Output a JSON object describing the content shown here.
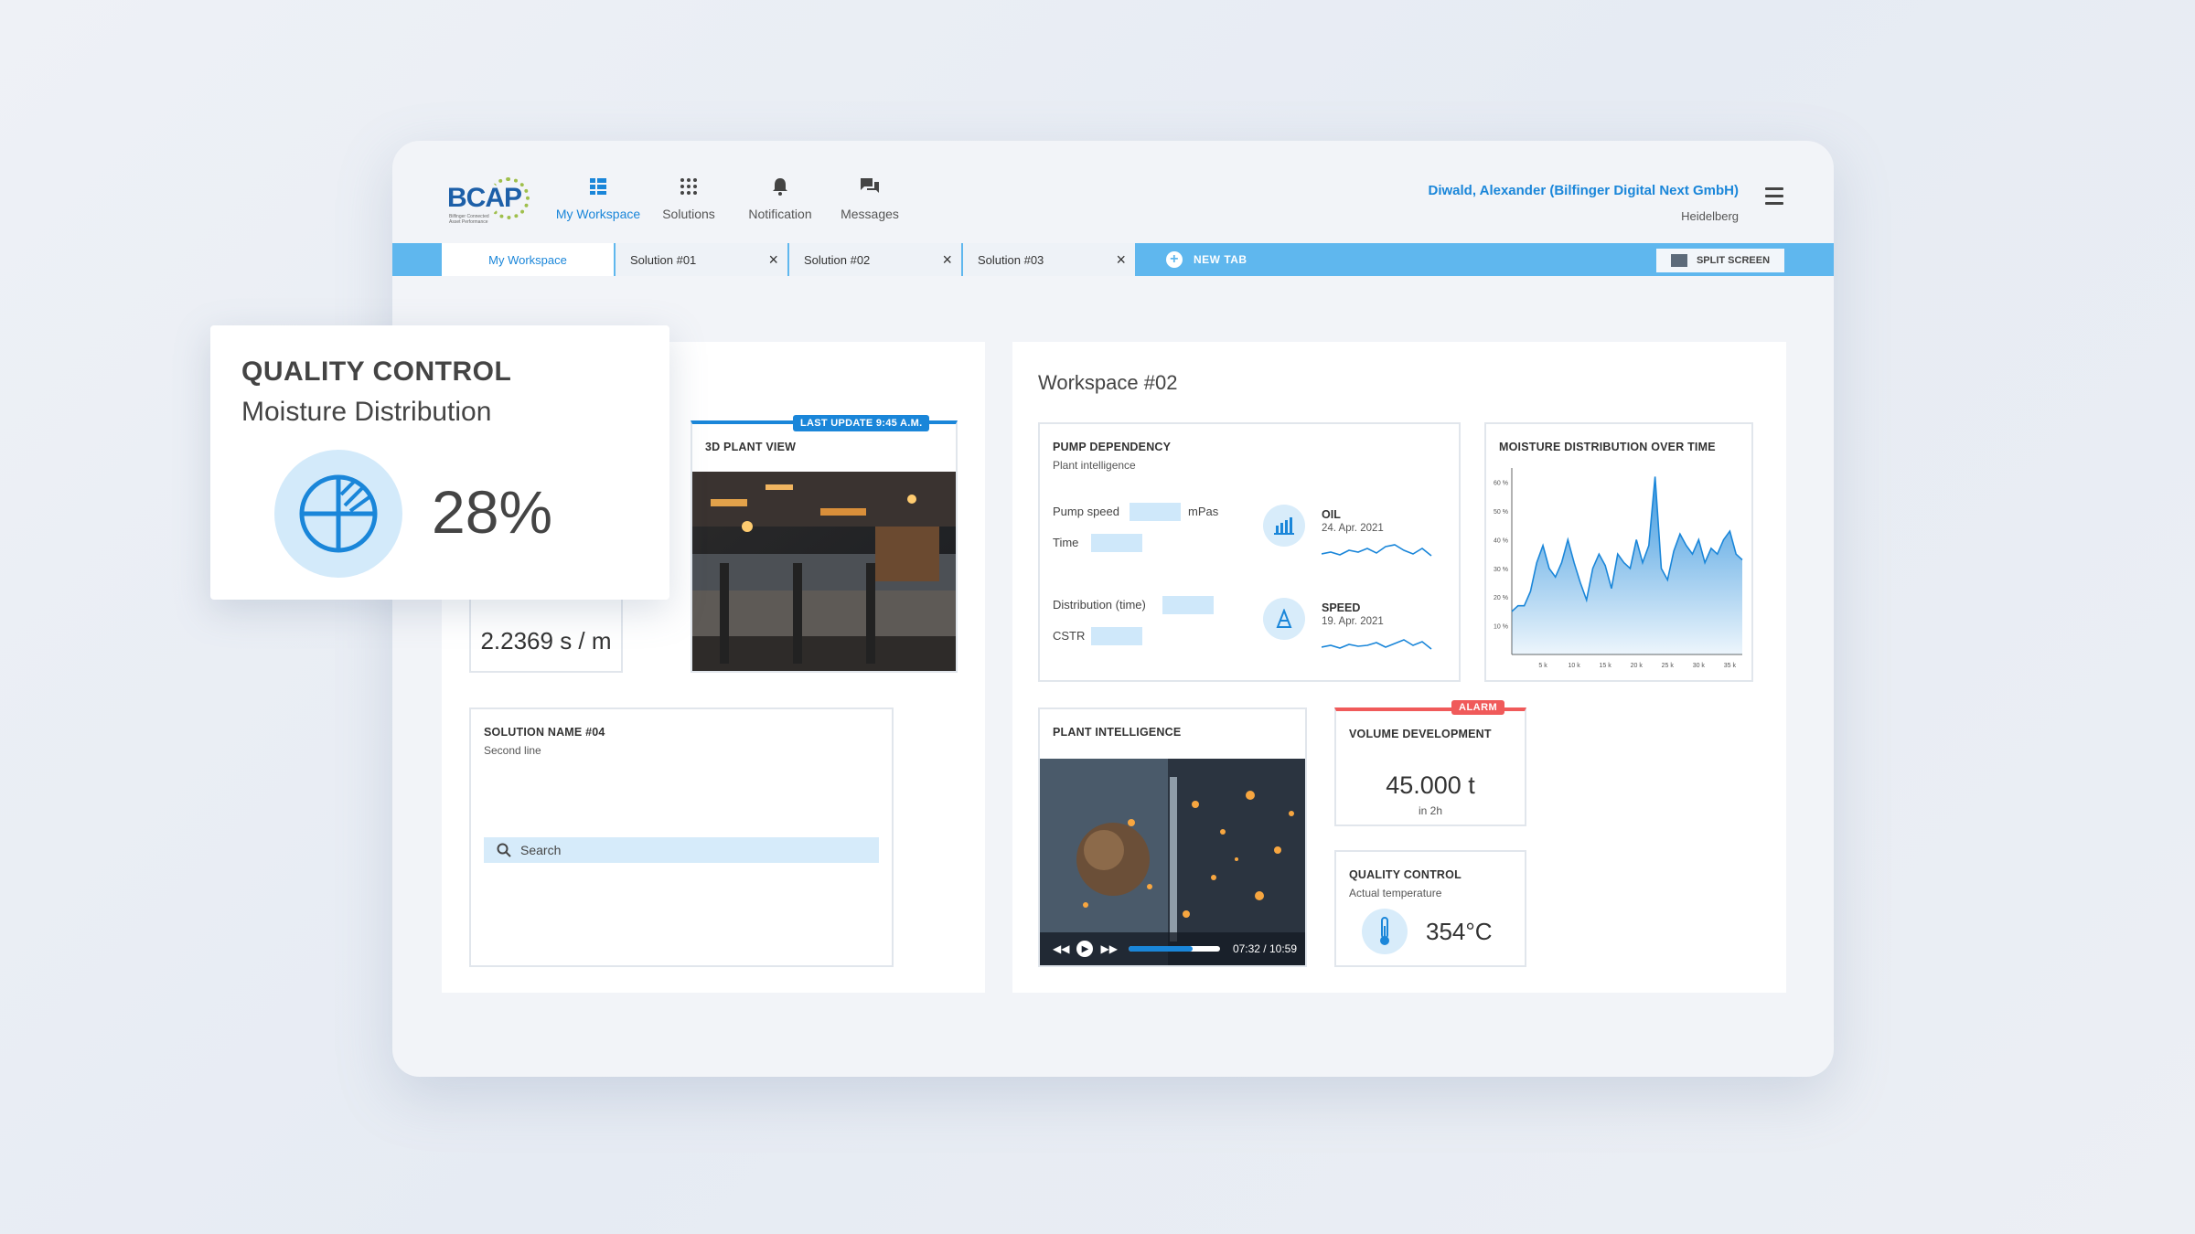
{
  "brand": {
    "name": "BCAP",
    "tagline": "Bilfinger Connected Asset Performance"
  },
  "nav": [
    {
      "label": "My Workspace",
      "icon": "workspace-icon",
      "active": true
    },
    {
      "label": "Solutions",
      "icon": "grid-icon",
      "active": false
    },
    {
      "label": "Notification",
      "icon": "bell-icon",
      "active": false
    },
    {
      "label": "Messages",
      "icon": "chat-icon",
      "active": false
    }
  ],
  "user": {
    "name": "Diwald, Alexander (Bilfinger Digital Next GmbH)",
    "location": "Heidelberg"
  },
  "tabs": [
    {
      "label": "My Workspace",
      "active": true
    },
    {
      "label": "Solution #01",
      "closable": true
    },
    {
      "label": "Solution #02",
      "closable": true
    },
    {
      "label": "Solution #03",
      "closable": true
    }
  ],
  "new_tab_label": "NEW TAB",
  "split_screen_label": "SPLIT SCREEN",
  "left_panel": {
    "plant_view": {
      "title": "3D PLANT VIEW",
      "badge": "LAST UPDATE 9:45 A.M."
    },
    "rate_value": "2.2369 s / m",
    "solution_card": {
      "title": "SOLUTION NAME #04",
      "subtitle": "Second line",
      "search_placeholder": "Search"
    }
  },
  "quality_popup": {
    "title": "QUALITY CONTROL",
    "subtitle": "Moisture Distribution",
    "value": "28%"
  },
  "workspace": {
    "title": "Workspace #02",
    "pump": {
      "title": "PUMP DEPENDENCY",
      "subtitle": "Plant intelligence",
      "fields": [
        {
          "label": "Pump speed",
          "unit": "mPas"
        },
        {
          "label": "Time",
          "unit": ""
        },
        {
          "label": "Distribution (time)",
          "unit": ""
        },
        {
          "label": "CSTR",
          "unit": ""
        }
      ],
      "metrics": [
        {
          "name": "OIL",
          "date": "24. Apr. 2021",
          "icon": "bar-chart-icon"
        },
        {
          "name": "SPEED",
          "date": "19. Apr. 2021",
          "icon": "speed-icon"
        }
      ]
    },
    "moisture_chart": {
      "title": "MOISTURE DISTRIBUTION OVER TIME"
    },
    "plant_intelligence": {
      "title": "PLANT INTELLIGENCE",
      "video_time": "07:32 / 10:59",
      "progress": 0.7
    },
    "volume": {
      "title": "VOLUME DEVELOPMENT",
      "alarm": "ALARM",
      "value": "45.000 t",
      "sub": "in 2h"
    },
    "quality": {
      "title": "QUALITY CONTROL",
      "subtitle": "Actual temperature",
      "value": "354°C"
    }
  },
  "chart_data": {
    "type": "area",
    "title": "MOISTURE DISTRIBUTION OVER TIME",
    "y_ticks": [
      "60 %",
      "50 %",
      "40 %",
      "30 %",
      "20 %",
      "10 %"
    ],
    "x_ticks": [
      "5 k",
      "10 k",
      "15 k",
      "20 k",
      "25 k",
      "30 k",
      "35 k"
    ],
    "ylim": [
      0,
      65
    ],
    "xlim": [
      0,
      37
    ],
    "x": [
      0,
      1,
      2,
      3,
      4,
      5,
      6,
      7,
      8,
      9,
      10,
      11,
      12,
      13,
      14,
      15,
      16,
      17,
      18,
      19,
      20,
      21,
      22,
      23,
      24,
      25,
      26,
      27,
      28,
      29,
      30,
      31,
      32,
      33,
      34,
      35,
      36,
      37
    ],
    "values": [
      15,
      17,
      17,
      22,
      32,
      38,
      30,
      27,
      32,
      40,
      32,
      25,
      19,
      30,
      35,
      31,
      23,
      35,
      32,
      30,
      40,
      32,
      38,
      62,
      30,
      26,
      36,
      42,
      38,
      35,
      40,
      32,
      37,
      35,
      40,
      43,
      35,
      33
    ],
    "color": "#1a86d9"
  },
  "colors": {
    "accent": "#1a86d9",
    "tabbar": "#5fb7ee",
    "alarm": "#f05a5a"
  }
}
